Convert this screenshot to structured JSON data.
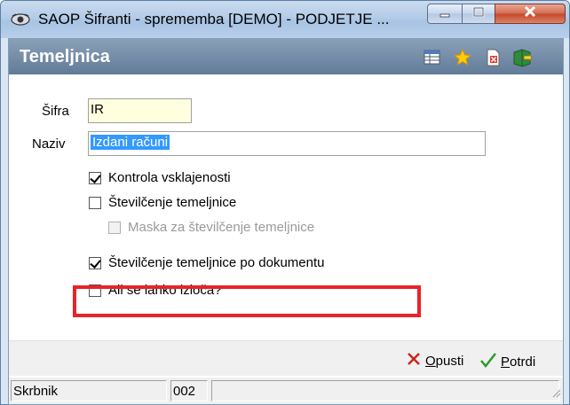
{
  "window": {
    "title": "SAOP Šifranti - sprememba [DEMO] - PODJETJE ...",
    "app_icon": "saop-eye-icon"
  },
  "header": {
    "title": "Temeljnica",
    "icons": [
      "table-icon",
      "star-icon",
      "document-delete-icon",
      "book-exit-icon"
    ]
  },
  "form": {
    "sifra_label": "Šifra",
    "sifra_value": "IR",
    "naziv_label": "Naziv",
    "naziv_value": "Izdani računi",
    "checkboxes": [
      {
        "label": "Kontrola vsklajenosti",
        "checked": true,
        "disabled": false
      },
      {
        "label": "Številčenje temeljnice",
        "checked": false,
        "disabled": false
      },
      {
        "label": "Maska za številčenje temeljnice",
        "checked": false,
        "disabled": true
      },
      {
        "label": "Številčenje temeljnice po dokumentu",
        "checked": true,
        "disabled": false
      },
      {
        "label": "Ali se lahko izloča?",
        "checked": false,
        "disabled": false
      }
    ]
  },
  "buttons": {
    "cancel_first": "O",
    "cancel_rest": "pusti",
    "confirm_first": "P",
    "confirm_rest": "otrdi"
  },
  "status": {
    "user": "Skrbnik",
    "code": "002",
    "extra": ""
  },
  "colors": {
    "highlight": "#e8232a",
    "header_bar": "#627b97",
    "selection": "#3399ff"
  }
}
